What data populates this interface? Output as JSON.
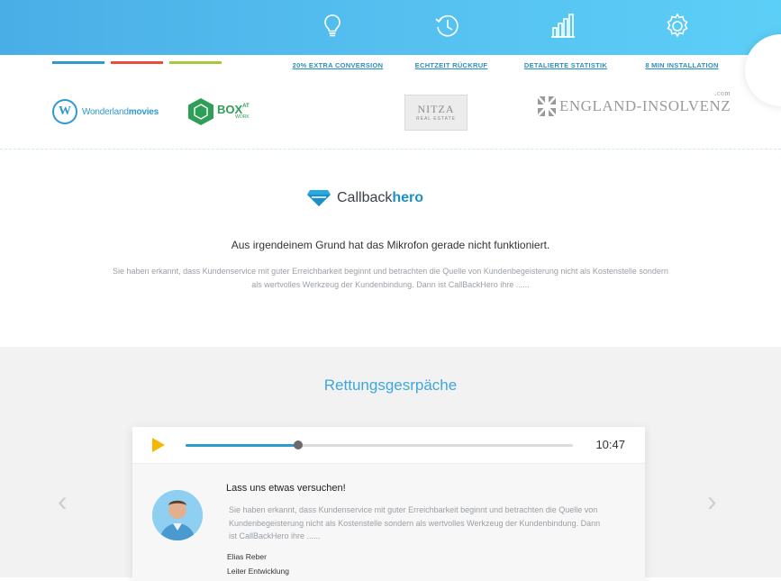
{
  "features": [
    {
      "icon": "lightbulb-icon",
      "label": "20% EXTRA CONVERSION"
    },
    {
      "icon": "clock-history-icon",
      "label": "ECHTZEIT RÜCKRUF"
    },
    {
      "icon": "bar-chart-icon",
      "label": "DETALIERTE STATISTIK"
    },
    {
      "icon": "gear-icon",
      "label": "8 MIN INSTALLATION"
    }
  ],
  "color_lines": [
    "#2e9ad0",
    "#e84c3d",
    "#a6c83b"
  ],
  "logos": {
    "wonderland": {
      "letter": "W",
      "name_part1": "Wonderland",
      "name_part2": "movies"
    },
    "box": {
      "name": "BOX",
      "sup": "AT",
      "sub": "WORK"
    },
    "nitza": {
      "name": "NITZA",
      "sub": "REAL ESTATE"
    },
    "england": {
      "name": "ENGLAND-INSOLVENZ",
      "sup": ".com"
    }
  },
  "brand": {
    "part1": "Callback",
    "part2": "hero"
  },
  "headline": "Aus irgendeinem Grund hat das Mikrofon gerade nicht funktioniert.",
  "intro": "Sie haben erkannt, dass Kundenservice mit guter Erreichbarkeit beginnt und betrachten die Quelle von Kundenbegeisterung nicht als Kostenstelle sondern als wertvolles Werkzeug der Kundenbindung. Dann ist CallBackHero ihre ......",
  "section_title": "Rettungsgesrpäche",
  "player": {
    "progress": 0.29,
    "time": "10:47"
  },
  "testimonial": {
    "title": "Lass uns etwas versuchen!",
    "text": "Sie haben erkannt, dass Kundenservice mit guter Erreichbarkeit beginnt und betrachten die Quelle von Kundenbegeisterung nicht als Kostenstelle sondern als wertvolles Werkzeug der Kundenbindung. Dann ist CallBackHero ihre ......",
    "name": "Elias  Reber",
    "role": "Leiter Entwicklung"
  },
  "nav": {
    "prev": "‹",
    "next": "›"
  }
}
